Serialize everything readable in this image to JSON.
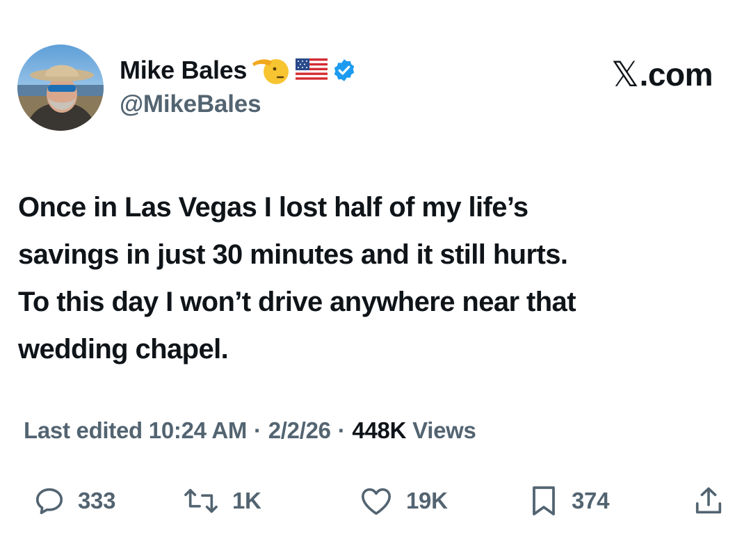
{
  "tweet": {
    "author": {
      "display_name": "Mike Bales",
      "handle": "@MikeBales",
      "badges": [
        "saluting-face-emoji",
        "us-flag-emoji",
        "verified-badge-icon"
      ]
    },
    "brand_prefix": "𝕏",
    "brand_suffix": ".com",
    "body_lines": [
      "Once in Las Vegas I lost half of my life’s",
      "savings in just 30 minutes and it still hurts.",
      "To this day I won’t drive anywhere near that",
      "wedding chapel."
    ],
    "meta": {
      "edited_label": "Last edited 10:24 AM",
      "separator": "·",
      "date": "2/2/26",
      "views_count": "448K",
      "views_label": "Views"
    },
    "actions": {
      "replies": "333",
      "reposts": "1K",
      "likes": "19K",
      "bookmarks": "374"
    },
    "colors": {
      "text": "#0f1419",
      "secondary": "#536471",
      "verified": "#1d9bf0"
    }
  }
}
